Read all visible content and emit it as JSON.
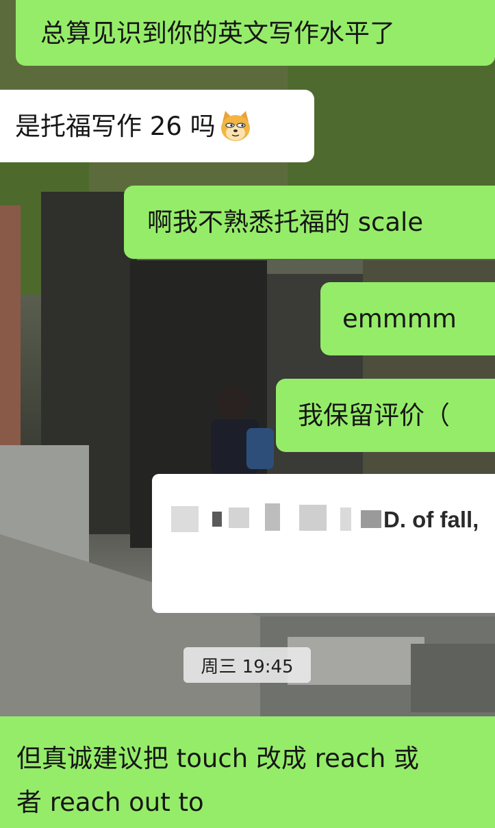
{
  "messages": [
    {
      "side": "out",
      "text": "总算见识到你的英文写作水平了"
    },
    {
      "side": "in",
      "text": "是托福写作 26 吗",
      "sticker": "doge-emoji"
    },
    {
      "side": "out",
      "text": "啊我不熟悉托福的 scale"
    },
    {
      "side": "out",
      "text": "emmmm"
    },
    {
      "side": "out",
      "text": "我保留评价（"
    },
    {
      "side": "out",
      "type": "image",
      "visible_text": "D. of fall,"
    }
  ],
  "timestamp": "周三 19:45",
  "last_message": {
    "side": "out",
    "line1": "但真诚建议把 touch 改成 reach 或",
    "line2": "者 reach out to"
  },
  "colors": {
    "outgoing_bubble": "#95ec69",
    "incoming_bubble": "#ffffff",
    "timestamp_bg": "#ebebeb"
  }
}
